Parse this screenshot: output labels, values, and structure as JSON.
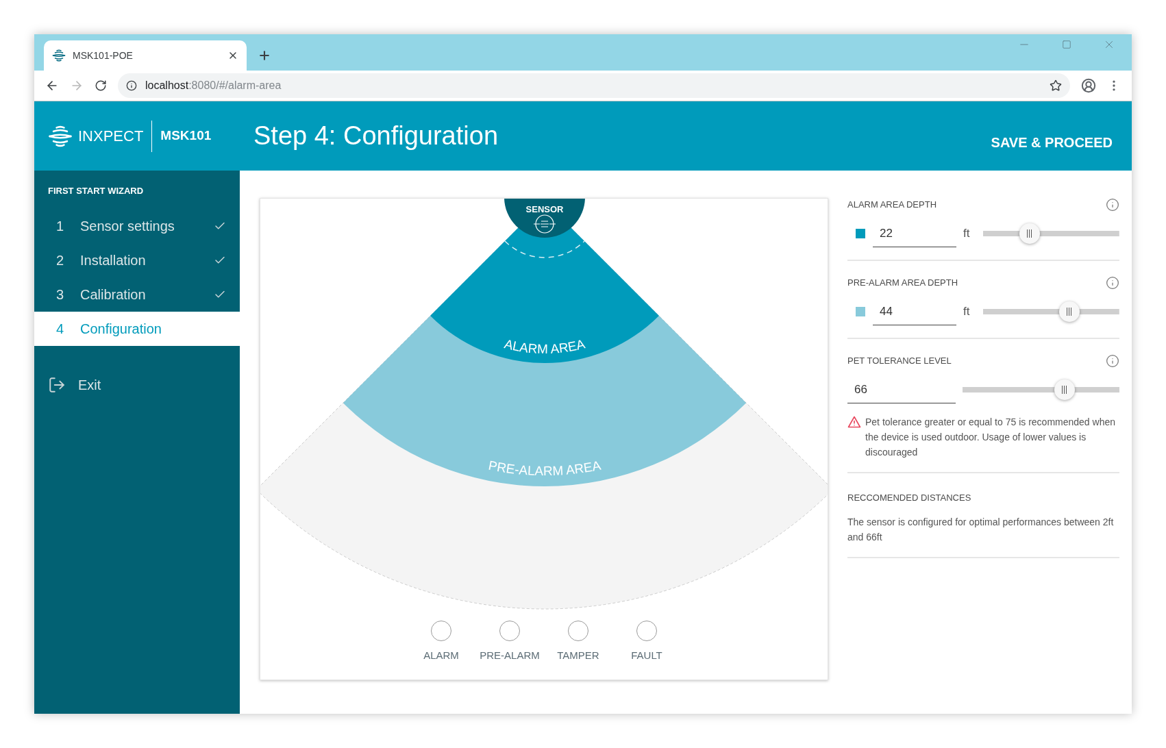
{
  "browser": {
    "tab_title": "MSK101-POE",
    "url_host": "localhost",
    "url_rest": ":8080/#/alarm-area"
  },
  "header": {
    "brand": "INXPECT",
    "product": "MSK101",
    "title": "Step 4: Configuration",
    "action": "SAVE & PROCEED"
  },
  "sidebar": {
    "heading": "FIRST START WIZARD",
    "steps": [
      {
        "number": "1",
        "label": "Sensor settings",
        "completed": true,
        "selected": false
      },
      {
        "number": "2",
        "label": "Installation",
        "completed": true,
        "selected": false
      },
      {
        "number": "3",
        "label": "Calibration",
        "completed": true,
        "selected": false
      },
      {
        "number": "4",
        "label": "Configuration",
        "completed": false,
        "selected": true
      }
    ],
    "exit": "Exit"
  },
  "diagram": {
    "sensor_label": "SENSOR",
    "areas": [
      {
        "label": "ALARM AREA",
        "color": "#009bbb"
      },
      {
        "label": "PRE-ALARM AREA",
        "color": "#88cadb"
      }
    ],
    "legend": [
      {
        "label": "ALARM",
        "on": false
      },
      {
        "label": "PRE-ALARM",
        "on": false
      },
      {
        "label": "TAMPER",
        "on": false
      },
      {
        "label": "FAULT",
        "on": false
      }
    ]
  },
  "settings": [
    {
      "kind": "depth",
      "title": "ALARM AREA DEPTH",
      "value": "22",
      "unit": "ft",
      "color": "#009bbb",
      "level": 0.34
    },
    {
      "kind": "depth",
      "title": "PRE-ALARM AREA DEPTH",
      "value": "44",
      "unit": "ft",
      "color": "#88cadb",
      "level": 0.63
    },
    {
      "kind": "plain",
      "title": "PET TOLERANCE LEVEL",
      "value": "66",
      "level": 0.65,
      "warning": "Pet tolerance greater or equal to 75 is recommended when the device is used outdoor. Usage of lower values is discouraged"
    }
  ],
  "recommended": {
    "title": "RECCOMENDED DISTANCES",
    "text": "The sensor is configured for optimal performances between 2ft and 66ft"
  }
}
